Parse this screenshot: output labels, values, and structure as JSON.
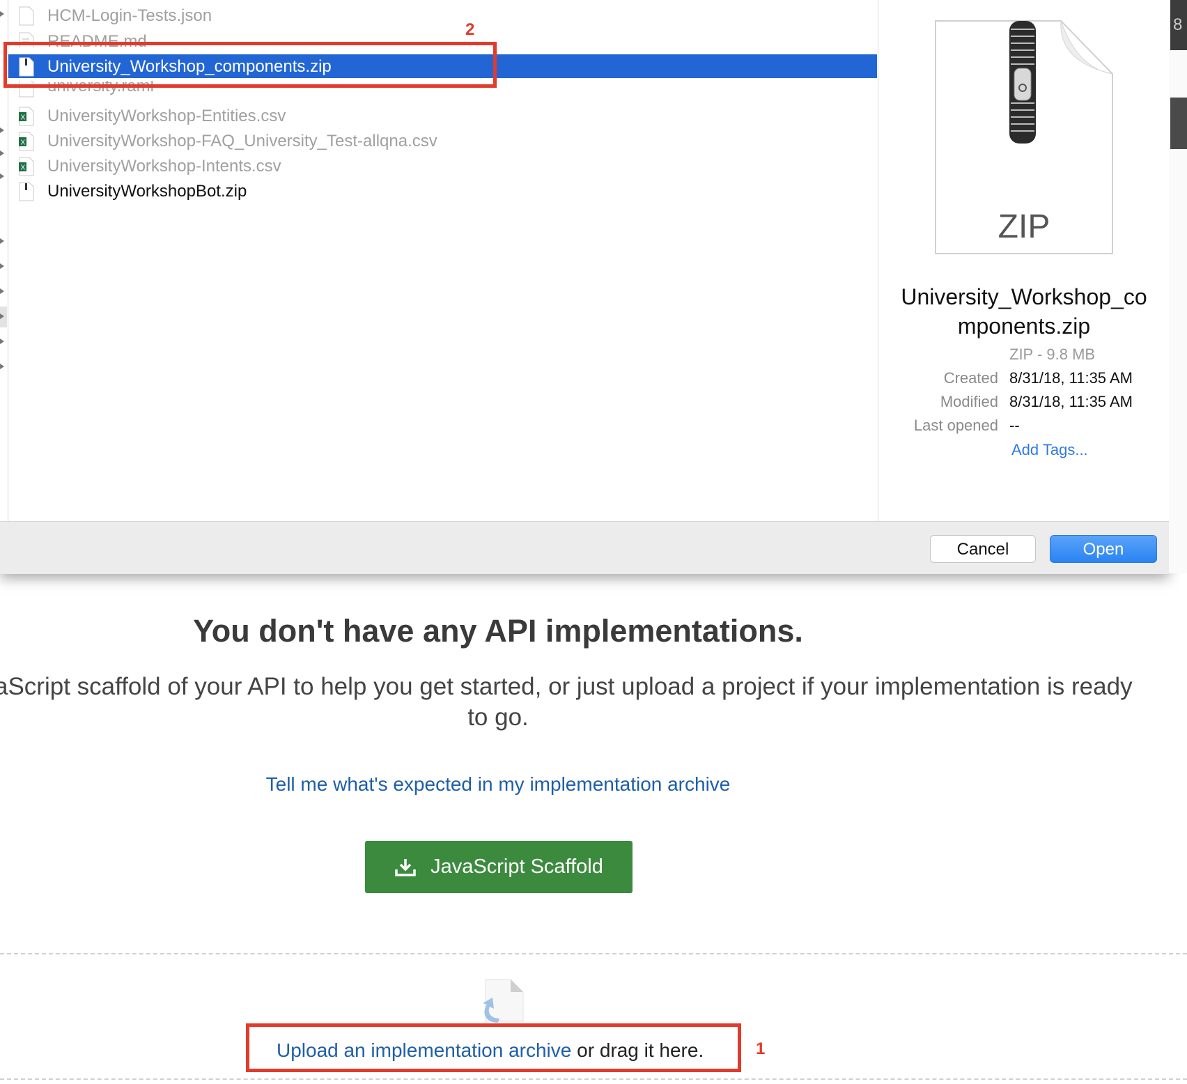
{
  "dialog": {
    "files": [
      {
        "name": "HCM-Login-Tests.json",
        "icon": "document-icon",
        "state": "dim"
      },
      {
        "name": "README.md",
        "icon": "text-document-icon",
        "state": "dim"
      },
      {
        "name": "University_Workshop_components.zip",
        "icon": "zip-icon",
        "state": "selected"
      },
      {
        "name": "university.raml",
        "icon": "document-icon",
        "state": "dim"
      },
      {
        "name": "UniversityWorkshop-Entities.csv",
        "icon": "excel-icon",
        "state": "dim"
      },
      {
        "name": "UniversityWorkshop-FAQ_University_Test-allqna.csv",
        "icon": "excel-icon",
        "state": "dim"
      },
      {
        "name": "UniversityWorkshop-Intents.csv",
        "icon": "excel-icon",
        "state": "dim"
      },
      {
        "name": "UniversityWorkshopBot.zip",
        "icon": "zip-icon",
        "state": "normal"
      }
    ],
    "preview": {
      "icon_label": "ZIP",
      "name_line1": "University_Workshop_co",
      "name_line2": "mponents.zip",
      "type_size": "ZIP - 9.8 MB",
      "created_label": "Created",
      "created_value": "8/31/18, 11:35 AM",
      "modified_label": "Modified",
      "modified_value": "8/31/18, 11:35 AM",
      "last_opened_label": "Last opened",
      "last_opened_value": "--",
      "add_tags": "Add Tags..."
    },
    "cancel_label": "Cancel",
    "open_label": "Open",
    "edge_text": "8"
  },
  "annotations": {
    "step1": "1",
    "step2": "2",
    "color": "#e13b2b"
  },
  "page": {
    "title": "You don't have any API implementations.",
    "subtitle_line1": "aScript scaffold of your API to help you get started, or just upload a project if your implementation is ready",
    "subtitle_line2": "to go.",
    "help_link": "Tell me what's expected in my implementation archive",
    "scaffold_button": "JavaScript Scaffold",
    "upload_link": "Upload an implementation archive",
    "upload_suffix": " or drag it here."
  },
  "colors": {
    "selection": "#2266d6",
    "open_button": "#2a83f3",
    "scaffold_button": "#3b8a3e",
    "link": "#1f5ea8",
    "tag_link": "#2f7be0"
  }
}
